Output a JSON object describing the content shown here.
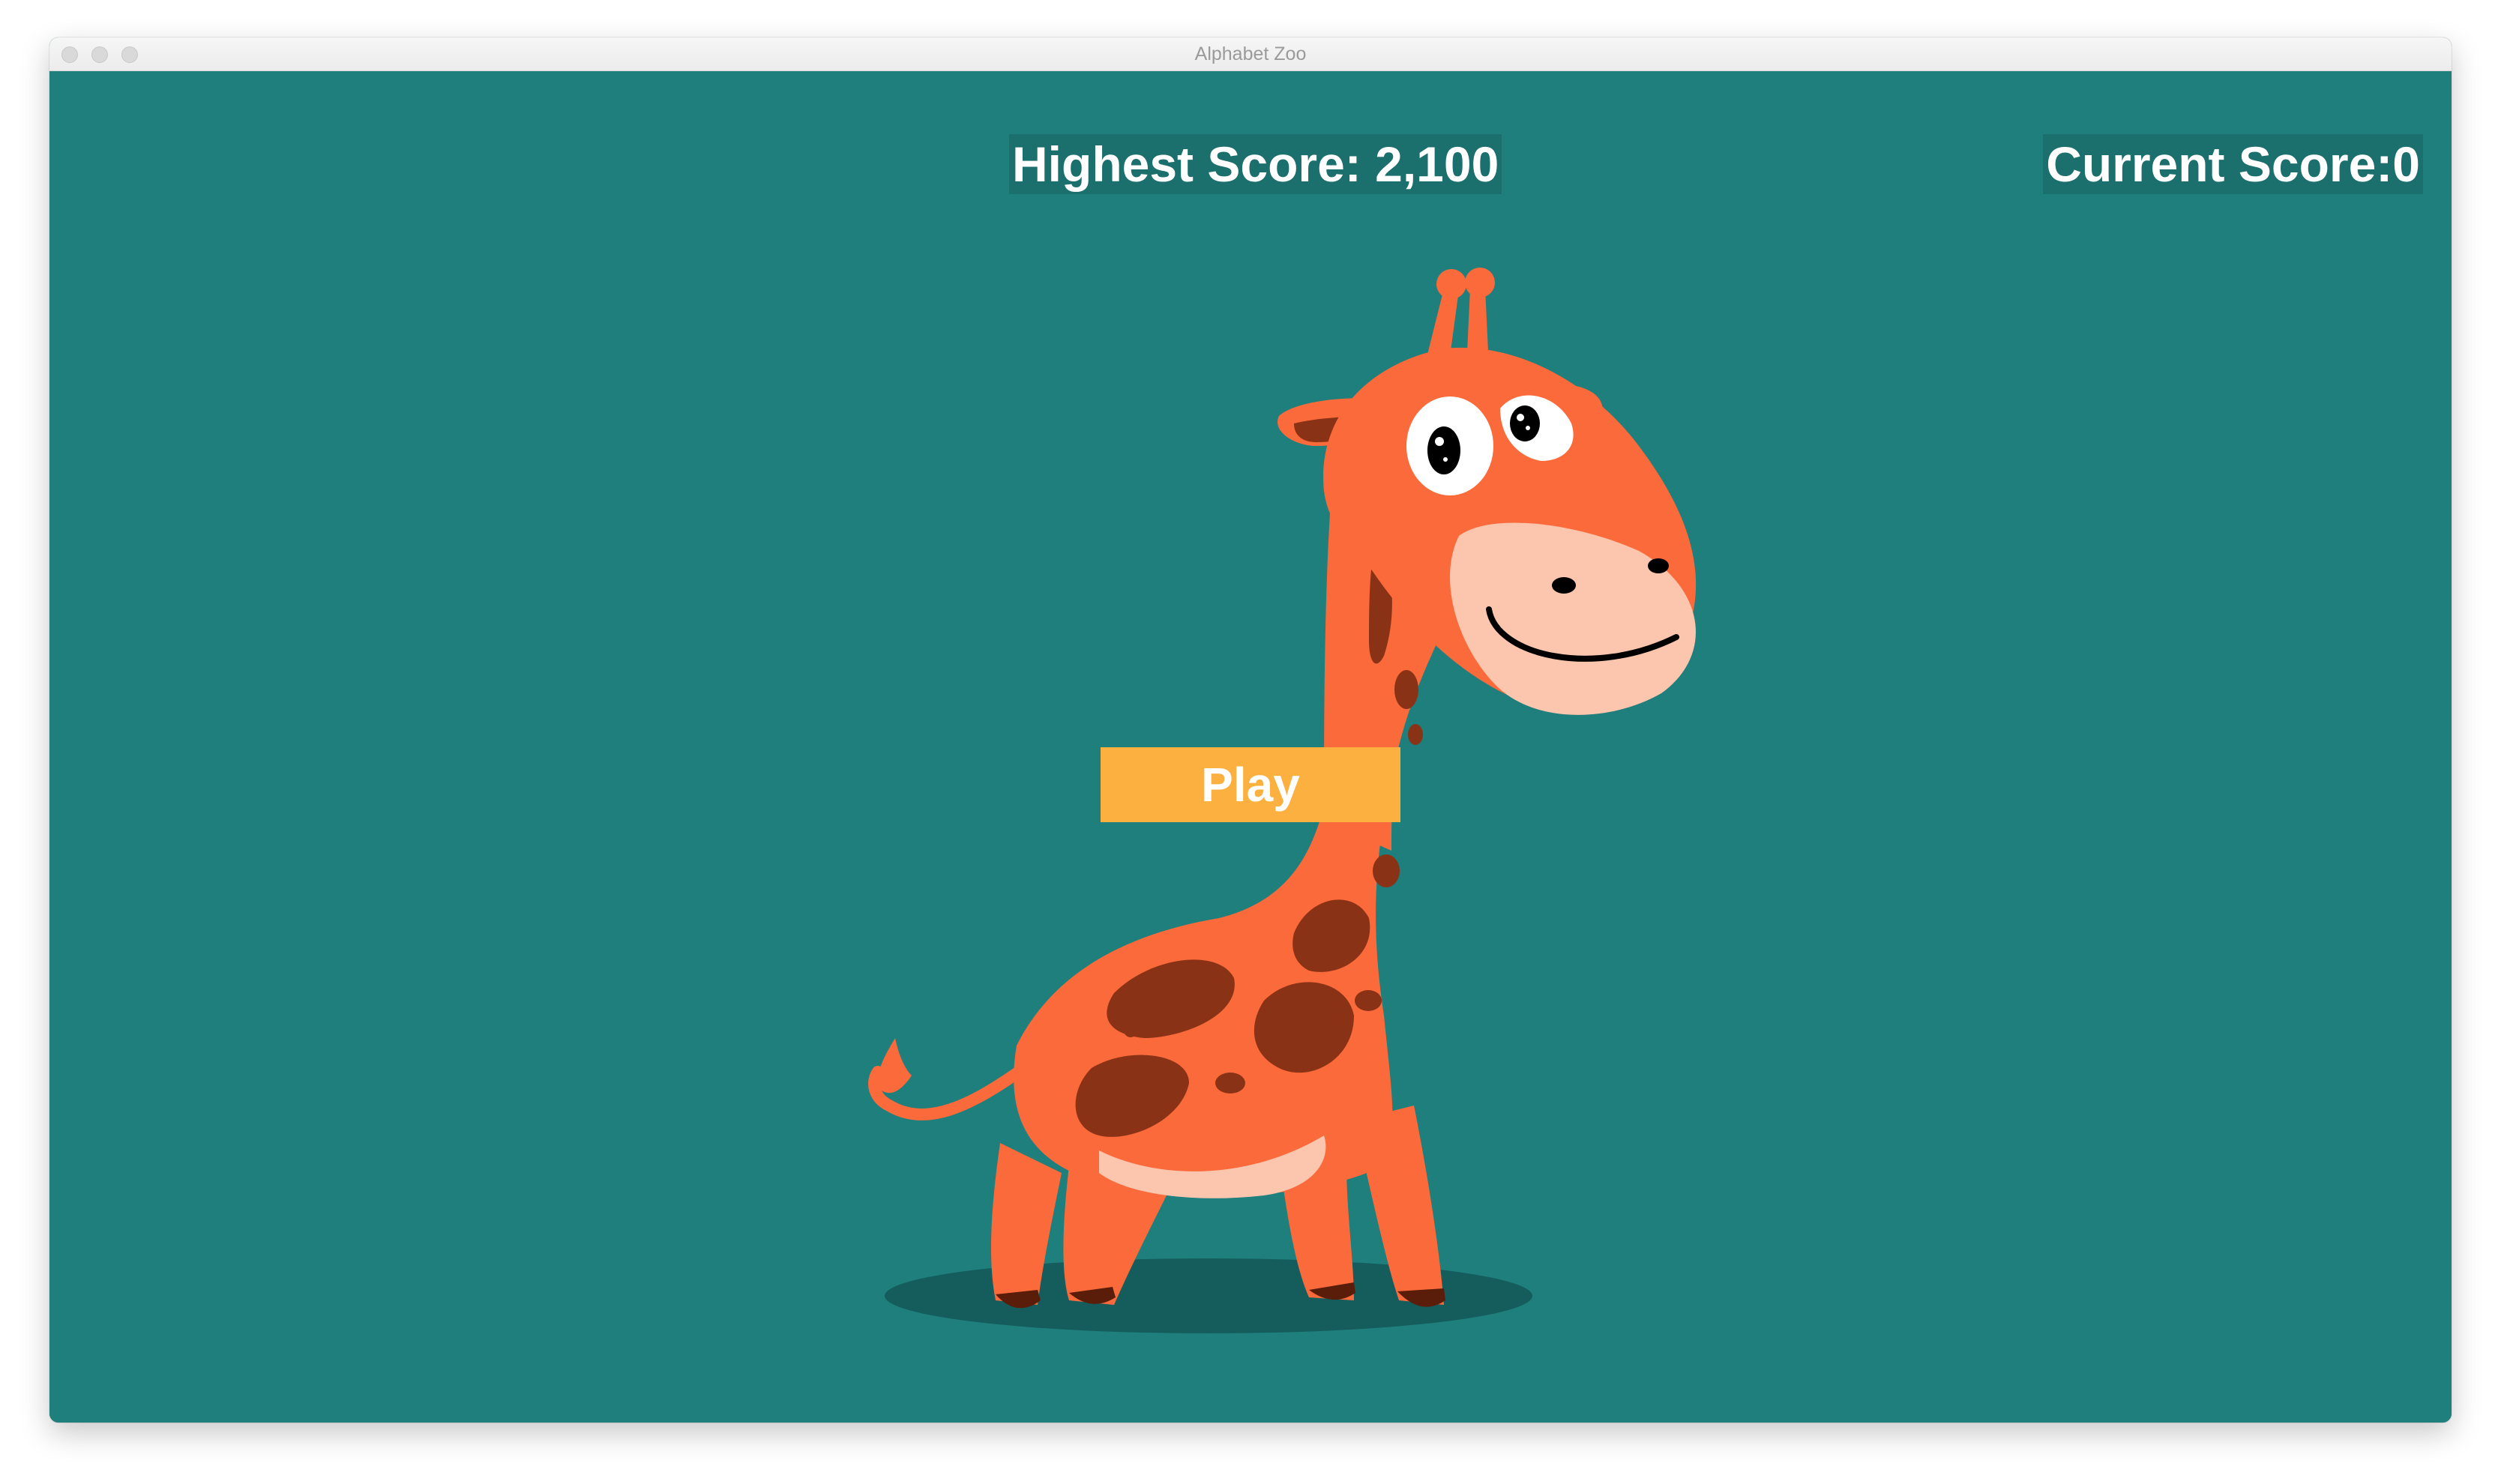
{
  "window": {
    "title": "Alphabet Zoo"
  },
  "scoreboard": {
    "highest_score": "Highest Score: 2,100",
    "current_score": "Current Score:0"
  },
  "menu": {
    "play_label": "Play"
  },
  "colors": {
    "background": "#1e7f7c",
    "button": "#fbb040",
    "giraffe_body": "#fb6a3a",
    "giraffe_spots": "#8a3216",
    "giraffe_muzzle": "#fcc5ae"
  },
  "illustration": {
    "subject": "giraffe"
  }
}
